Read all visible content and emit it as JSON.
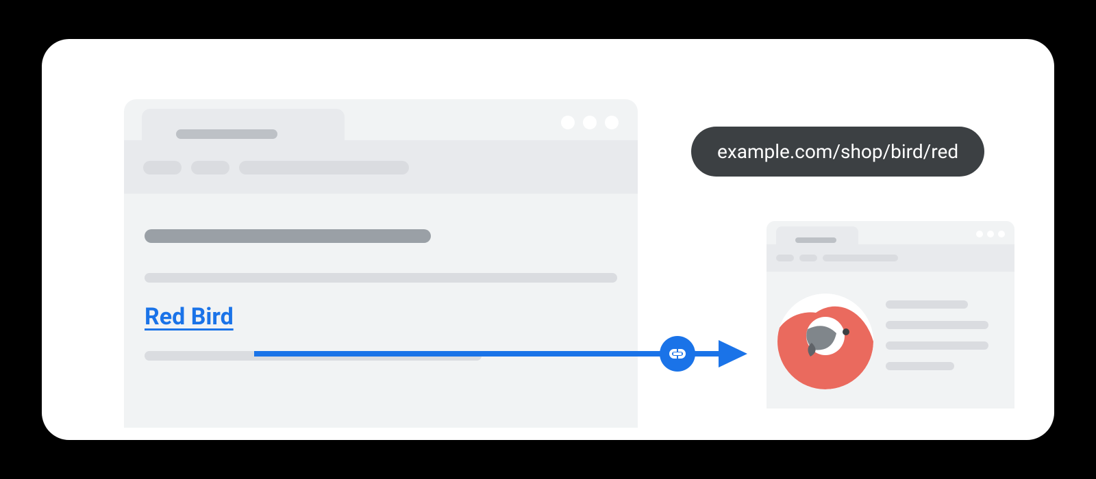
{
  "diagram": {
    "link_anchor_text": "Red Bird",
    "destination_url": "example.com/shop/bird/red"
  },
  "icons": {
    "link_icon": "link-icon",
    "arrow": "arrow-right-icon",
    "bird": "parrot-icon"
  },
  "colors": {
    "link": "#1a73e8",
    "pill_bg": "#3c4043",
    "gray_light": "#e8eaed",
    "gray_lighter": "#f1f3f4",
    "gray_bar": "#dadce0",
    "gray_dark_bar": "#9aa0a6",
    "bird_red": "#ea6a5e",
    "bird_beak": "#80868b"
  }
}
